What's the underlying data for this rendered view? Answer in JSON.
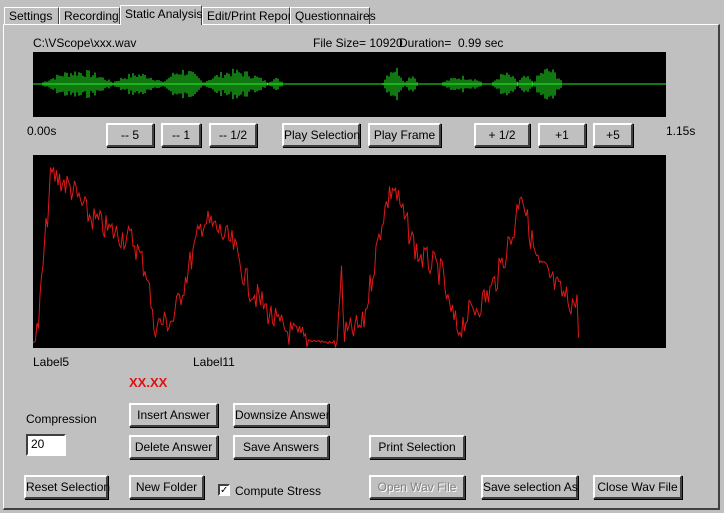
{
  "tabs": [
    {
      "label": "Settings"
    },
    {
      "label": "Recording"
    },
    {
      "label": "Static Analysis"
    },
    {
      "label": "Edit/Print Report"
    },
    {
      "label": "Questionnaires"
    }
  ],
  "active_tab": "Static Analysis",
  "file": {
    "path": "C:\\VScope\\xxx.wav",
    "size_text": "File Size= 10920",
    "duration_label": "Duration=",
    "duration_value": "0.99 sec"
  },
  "timeline": {
    "start": "0.00s",
    "end": "1.15s"
  },
  "nav_buttons": {
    "minus5": "-- 5",
    "minus1": "-- 1",
    "minus_half": "-- 1/2",
    "play_selection": "Play Selection",
    "play_frame": "Play Frame",
    "plus_half": "+ 1/2",
    "plus1": "+1",
    "plus5": "+5"
  },
  "labels": {
    "label_a": "Label5",
    "label_b": "Label11",
    "score": "XX.XX"
  },
  "compression": {
    "label": "Compression",
    "value": "20"
  },
  "buttons": {
    "insert_answer": "Insert Answer",
    "downsize_answer": "Downsize Answer",
    "delete_answer": "Delete Answer",
    "save_answers": "Save Answers",
    "print_selection": "Print Selection",
    "reset_selection": "Reset Selection",
    "new_folder": "New Folder",
    "open_wav": "Open Wav File",
    "save_selection_as": "Save selection As",
    "close_wav": "Close Wav File"
  },
  "compute_stress": {
    "label": "Compute Stress",
    "checked": true,
    "mark": "✓"
  },
  "colors": {
    "waveform": "#22ee22",
    "analysis": "#e01818",
    "screen": "#000000"
  }
}
